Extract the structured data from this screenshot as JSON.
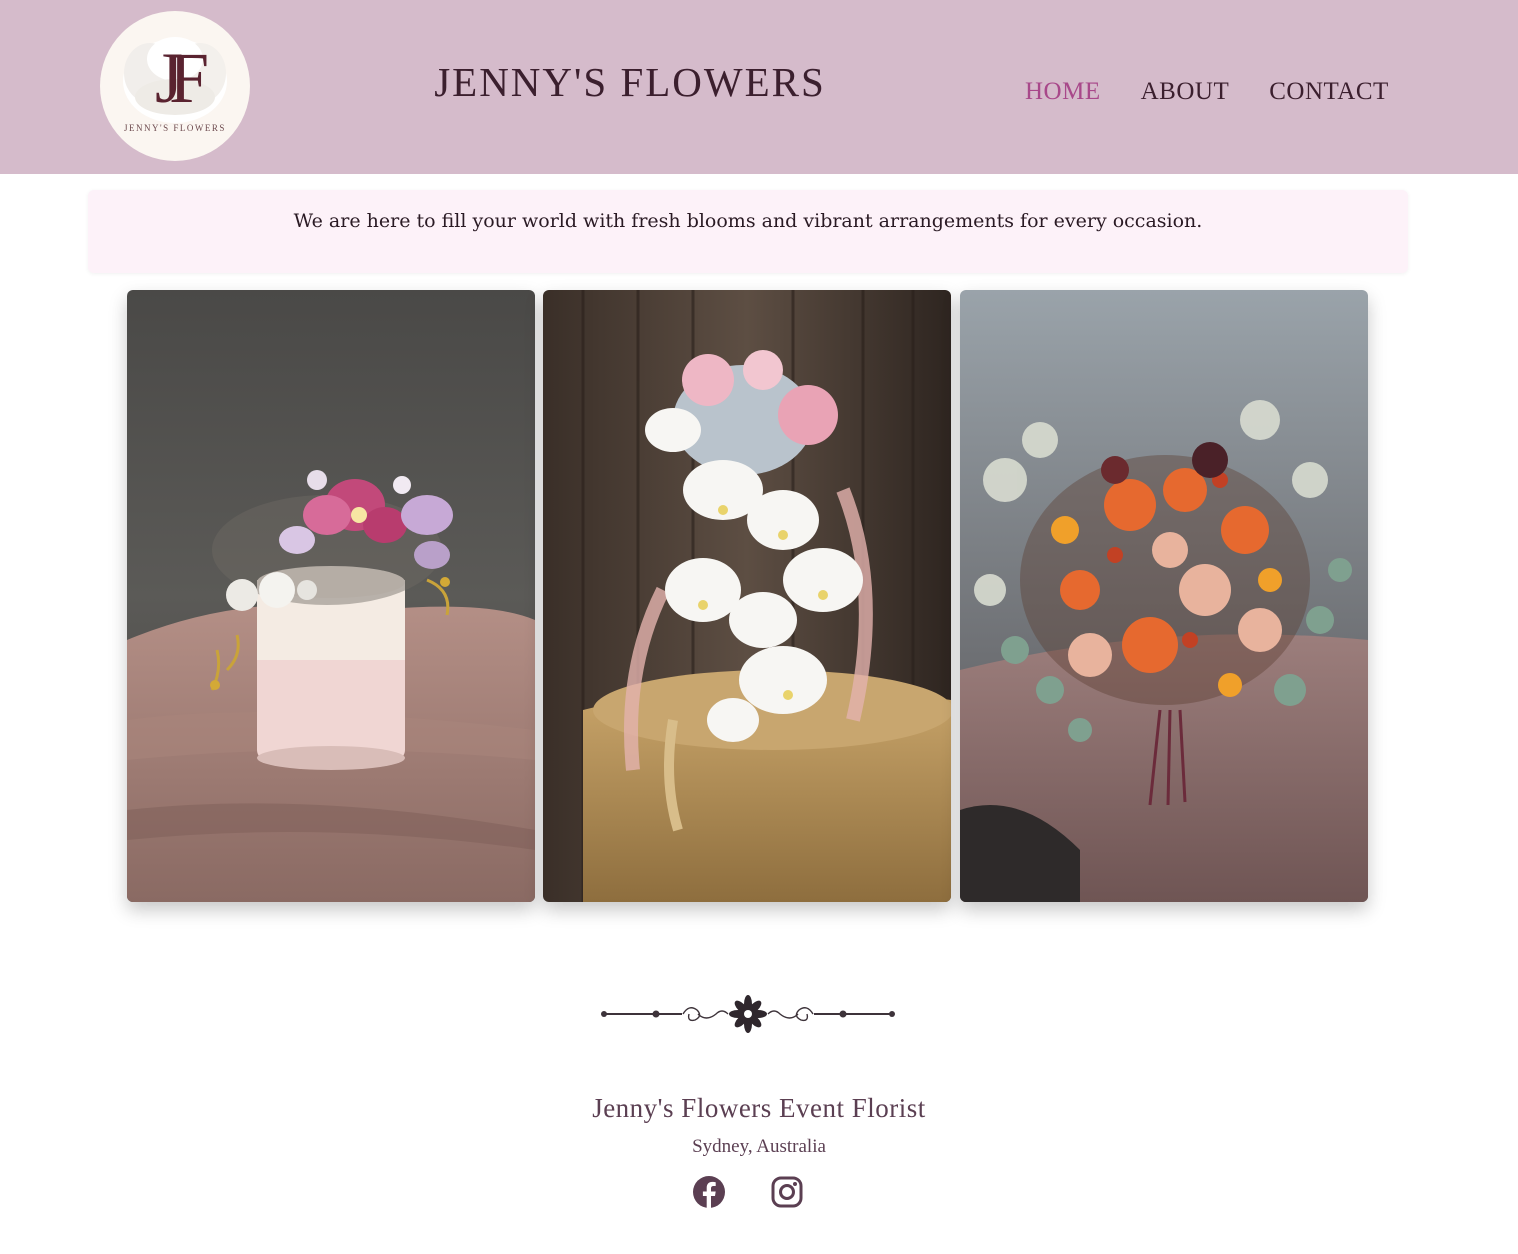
{
  "brand": {
    "logo_monogram": "JF",
    "logo_caption": "JENNY'S FLOWERS",
    "site_title": "JENNY'S FLOWERS"
  },
  "nav": {
    "items": [
      {
        "label": "HOME",
        "active": true
      },
      {
        "label": "ABOUT",
        "active": false
      },
      {
        "label": "CONTACT",
        "active": false
      }
    ]
  },
  "tagline": "We are here to fill your world with fresh blooms and vibrant arrangements for every occasion.",
  "gallery": [
    {
      "subject": "pink orchid arrangement in a pink hat box"
    },
    {
      "subject": "white orchid cascading bridal bouquet"
    },
    {
      "subject": "orange and peach rose bouquet with eucalyptus"
    }
  ],
  "footer": {
    "title": "Jenny's Flowers Event Florist",
    "location": "Sydney, Australia",
    "social": [
      {
        "icon": "facebook-icon"
      },
      {
        "icon": "instagram-icon"
      }
    ]
  },
  "colors": {
    "header_bg": "#d5bbcb",
    "nav_active": "#a8488a",
    "nav_text": "#3b1f2e",
    "tagline_bg": "#fdf2f9",
    "footer_text": "#5b3f52"
  }
}
